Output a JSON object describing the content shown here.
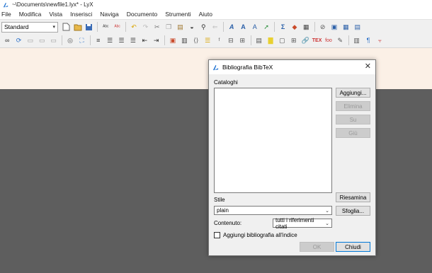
{
  "window": {
    "title": "~\\Documents\\newfile1.lyx* - LyX"
  },
  "menu": [
    "File",
    "Modifica",
    "Vista",
    "Inserisci",
    "Naviga",
    "Documento",
    "Strumenti",
    "Aiuto"
  ],
  "toolbar": {
    "paragraph_style": "Standard"
  },
  "colors": {
    "document_background": "#fbf0e6",
    "workspace_background": "#5e5e5e",
    "dialog_background": "#f0f0f0"
  },
  "dialog": {
    "title": "Bibliografia BibTeX",
    "catalogs_label": "Cataloghi",
    "add_button": "Aggiungi...",
    "delete_button": "Elimina",
    "up_button": "Su",
    "down_button": "Giù",
    "rescan_button": "Riesamina",
    "style_label": "Stile",
    "style_value": "plain",
    "browse_button": "Sfoglia...",
    "content_label": "Contenuto:",
    "content_value": "tutti i riferimenti citati",
    "add_to_index_label": "Aggiungi bibliografia all'indice",
    "ok_button": "OK",
    "close_button": "Chiudi"
  }
}
